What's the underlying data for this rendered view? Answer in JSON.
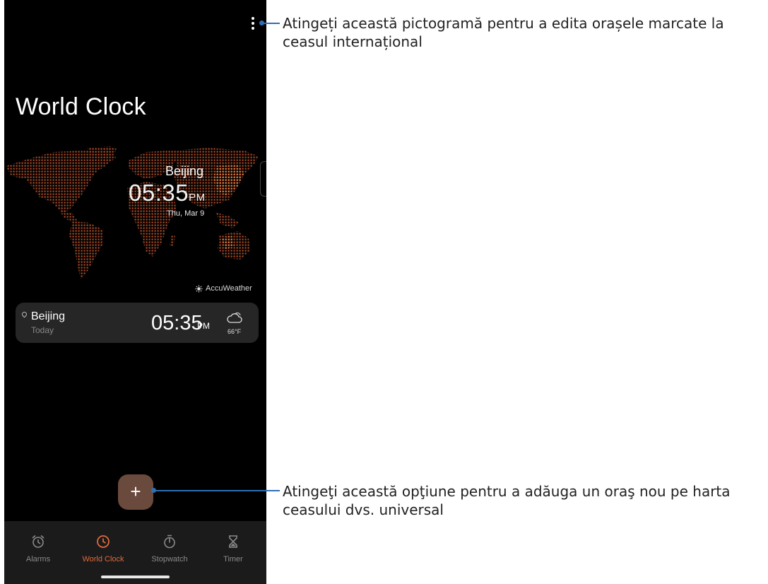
{
  "header": {
    "title": "World Clock"
  },
  "map": {
    "city": "Beijing",
    "time": "05:35",
    "ampm": "PM",
    "date": "Thu, Mar 9",
    "attribution": "AccuWeather"
  },
  "card": {
    "city": "Beijing",
    "day": "Today",
    "time": "05:35",
    "ampm": "PM",
    "temp": "66°F"
  },
  "fab": {
    "label": "+"
  },
  "nav": {
    "items": [
      {
        "label": "Alarms",
        "icon": "alarm-icon"
      },
      {
        "label": "World Clock",
        "icon": "clock-icon",
        "active": true
      },
      {
        "label": "Stopwatch",
        "icon": "stopwatch-icon"
      },
      {
        "label": "Timer",
        "icon": "hourglass-icon"
      }
    ]
  },
  "callouts": {
    "menu": "Atingeți această pictogramă pentru a edita orașele marcate la ceasul internațional",
    "add": "Atingeţi această opţiune pentru a adăuga un oraş nou pe harta ceasului dvs. universal"
  },
  "colors": {
    "accent": "#e06a3c",
    "fab": "#6b4a3e",
    "card": "#262626",
    "nav": "#1b1b1b",
    "leader": "#2d6fb5",
    "map_dots": "#b4502c"
  }
}
